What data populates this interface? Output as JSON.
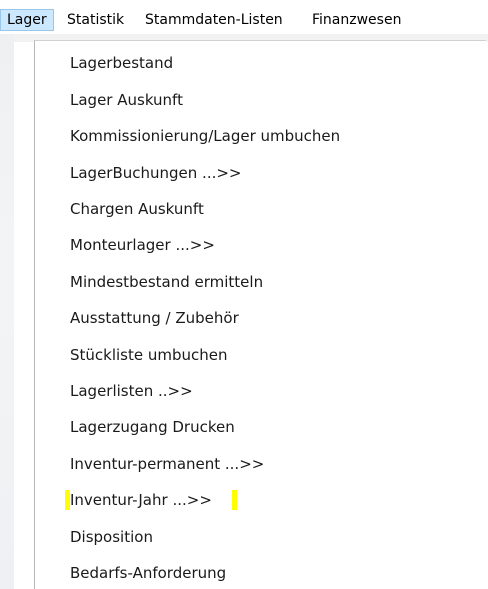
{
  "menubar": {
    "items": [
      {
        "label": "Lager",
        "active": true
      },
      {
        "label": "Statistik",
        "active": false
      },
      {
        "label": "Stammdaten-Listen",
        "active": false
      },
      {
        "label": "Finanzwesen",
        "active": false
      }
    ]
  },
  "dropdown": {
    "items": [
      {
        "label": "Lagerbestand"
      },
      {
        "label": "Lager Auskunft"
      },
      {
        "label": "Kommissionierung/Lager umbuchen"
      },
      {
        "label": "LagerBuchungen ...>>"
      },
      {
        "label": "Chargen Auskunft"
      },
      {
        "label": "Monteurlager ...>>"
      },
      {
        "label": "Mindestbestand ermitteln"
      },
      {
        "label": "Ausstattung / Zubehör"
      },
      {
        "label": "Stückliste umbuchen"
      },
      {
        "label": "Lagerlisten ..>>"
      },
      {
        "label": "Lagerzugang Drucken"
      },
      {
        "label": "Inventur-permanent ...>>"
      },
      {
        "label": "Inventur-Jahr ...>>",
        "highlighted": true
      },
      {
        "label": "Disposition"
      },
      {
        "label": "Bedarfs-Anforderung"
      }
    ]
  },
  "colors": {
    "active_menu_bg": "#cce8ff",
    "active_menu_border": "#9ac6ea",
    "highlight_marker": "#ffff00"
  }
}
